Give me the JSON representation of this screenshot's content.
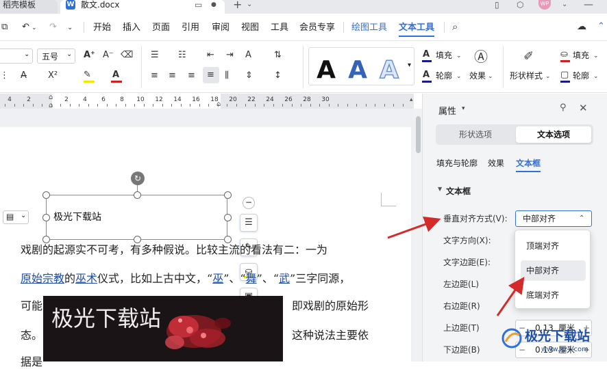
{
  "titlebar": {
    "prev_tab": "稻壳模板",
    "current_tab": "散文.docx",
    "avatar_text": "WP"
  },
  "menubar": {
    "items": [
      "开始",
      "插入",
      "页面",
      "引用",
      "审阅",
      "视图",
      "工具",
      "会员专享",
      "绘图工具",
      "文本工具"
    ]
  },
  "ribbon": {
    "font_size": "五号",
    "fill_label": "填充",
    "outline_label": "轮廓",
    "effect_label": "效果",
    "shape_style_label": "形状样式",
    "shape_fill_label": "填充",
    "shape_outline_label": "轮廓",
    "art_letter": "A"
  },
  "ruler": {
    "labels": [
      "4",
      "2",
      "2",
      "4",
      "6",
      "8",
      "10",
      "12",
      "14",
      "16",
      "18",
      "20",
      "22",
      "24",
      "26",
      "28",
      "30"
    ]
  },
  "document": {
    "textbox_text": "极光下载站",
    "line1": "戏剧的起源实不可考，有多种假说。比较主流的看法有二：一为",
    "line2_parts": [
      "原始宗教",
      "的",
      "巫术",
      "仪式，比如上古中文，“",
      "巫",
      "”、“",
      "舞",
      "”、“",
      "武",
      "”三字同源，"
    ],
    "line3_start": "可能",
    "line3_end": "即戏剧的原始形",
    "line4_start": "态。",
    "line4_end": "这种说法主要依",
    "line5_start": "据是",
    "image_text": "极光下载站"
  },
  "panel": {
    "title": "属性",
    "seg_shape": "形状选项",
    "seg_text": "文本选项",
    "tabs": [
      "填充与轮廓",
      "效果",
      "文本框"
    ],
    "section": "文本框",
    "fields": {
      "valign_label": "垂直对齐方式(V):",
      "valign_value": "中部对齐",
      "direction_label": "文字方向(X):",
      "margin_label": "文字边距(E):",
      "left_label": "左边距(L)",
      "right_label": "右边距(R)",
      "top_label": "上边距(T)",
      "top_value": "0.13",
      "top_unit": "厘米",
      "bottom_label": "下边距(B)",
      "bottom_value": "0.13",
      "bottom_unit": "厘米"
    },
    "dropdown_options": [
      "顶端对齐",
      "中部对齐",
      "底端对齐"
    ],
    "dropdown_selected": "中部对齐"
  },
  "watermark": {
    "text": "极光下载站",
    "url": "www.xz7.com"
  },
  "colors": {
    "accent": "#2f6fde",
    "arrow": "#d42a2a",
    "link": "#1f4ba8"
  }
}
